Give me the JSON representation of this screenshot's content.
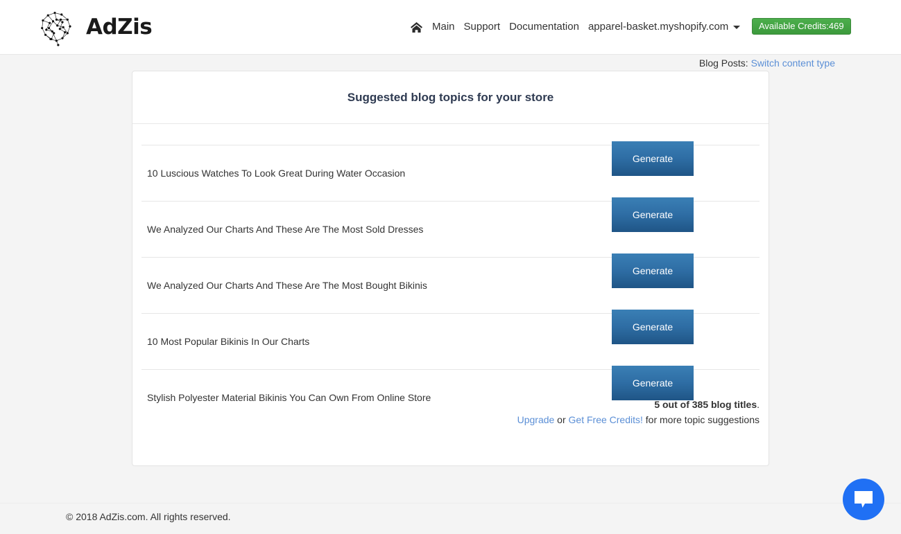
{
  "header": {
    "brand_name": "AdZis",
    "logo_icon": "brain-network-icon",
    "home_icon": "home-icon",
    "nav_items": [
      {
        "label": "Main"
      },
      {
        "label": "Support"
      },
      {
        "label": "Documentation"
      }
    ],
    "store_dropdown": {
      "label": "apparel-basket.myshopify.com",
      "caret_icon": "caret-down-icon"
    },
    "credits_button": {
      "label": "Available Credits:469",
      "color": "#449d44"
    }
  },
  "subheader": {
    "content_type_label": "Blog Posts:",
    "switch_link": "Switch content type",
    "link_color": "#5b8fd6"
  },
  "card": {
    "title": "Suggested blog topics for your store",
    "title_color": "#2f3b52",
    "generate_label": "Generate",
    "generate_color": "#2e6da4",
    "topics": [
      {
        "title": "10 Luscious Watches To Look Great During Water Occasion"
      },
      {
        "title": "We Analyzed Our Charts And These Are The Most Sold Dresses"
      },
      {
        "title": "We Analyzed Our Charts And These Are The Most Bought Bikinis"
      },
      {
        "title": "10 Most Popular Bikinis In Our Charts"
      },
      {
        "title": "Stylish Polyester Material Bikinis You Can Own From Online Store"
      }
    ],
    "footer": {
      "count_text": "5 out of 385 blog titles",
      "count_suffix": ".",
      "upgrade_link": "Upgrade",
      "or_text": " or ",
      "free_credits_link": "Get Free Credits!",
      "suggestion_text": " for more topic suggestions"
    }
  },
  "page_footer": {
    "copyright": "© 2018 AdZis.com. All rights reserved."
  },
  "chat": {
    "icon": "chat-bubble-icon",
    "color": "#2070f4"
  }
}
